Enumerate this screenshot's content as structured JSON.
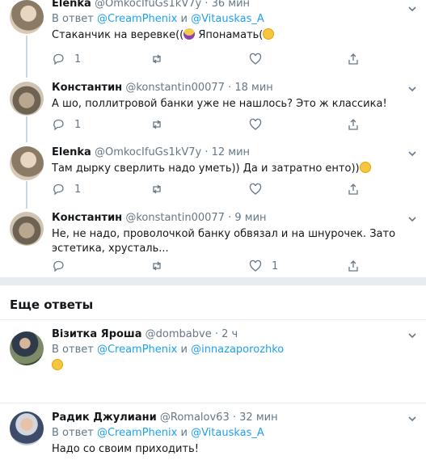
{
  "tweets": [
    {
      "name": "Elenka",
      "handle": "@OmkocIfuGs1kV7y",
      "dot": "·",
      "time": "36 мин",
      "reply_prefix": "В ответ",
      "reply_user1": "@CreamPhenix",
      "reply_and": "и",
      "reply_user2": "@Vitauskas_A",
      "text": "Стаканчик на веревке((",
      "text_after_emoji": " Японамать(",
      "emoji1": "person-facepalming-emoji",
      "emoji2": "flushed-face-emoji",
      "reply_count": "1",
      "retweet_count": "",
      "like_count": ""
    },
    {
      "name": "Константин",
      "handle": "@konstantin00077",
      "dot": "·",
      "time": "18 мин",
      "text": "А шо, поллитровой банки уже не нашлось? Это ж классика!",
      "reply_count": "1",
      "retweet_count": "",
      "like_count": ""
    },
    {
      "name": "Elenka",
      "handle": "@OmkocIfuGs1kV7y",
      "dot": "·",
      "time": "12 мин",
      "text": "Там дырку сверлить надо уметь)) Да и затратно енто))",
      "emoji": "hugging-face-emoji",
      "reply_count": "1",
      "retweet_count": "",
      "like_count": ""
    },
    {
      "name": "Константин",
      "handle": "@konstantin00077",
      "dot": "·",
      "time": "9 мин",
      "text": "Не, не надо, проволочкой банку обвязал и на шнурочек. Зато эстетика, хрусталь...",
      "reply_count": "",
      "retweet_count": "",
      "like_count": "1"
    }
  ],
  "more_replies_title": "Еще ответы",
  "more_replies": [
    {
      "name": "Візитка Яроша",
      "handle": "@dombabve",
      "dot": "·",
      "time": "2 ч",
      "reply_prefix": "В ответ",
      "reply_user1": "@CreamPhenix",
      "reply_and": "и",
      "reply_user2": "@innazaporozhko",
      "emoji": "rolling-on-floor-laughing-emoji"
    },
    {
      "name": "Радик Джулиани",
      "handle": "@Romalov63",
      "dot": "·",
      "time": "32 мин",
      "reply_prefix": "В ответ",
      "reply_user1": "@CreamPhenix",
      "reply_and": "и",
      "reply_user2": "@Vitauskas_A",
      "text": "Надо со своим приходить!"
    }
  ],
  "colors": {
    "link": "#1da1f2",
    "secondary_text": "#657786",
    "divider": "#e6ecf0",
    "thread_line": "#ccd6dd"
  }
}
